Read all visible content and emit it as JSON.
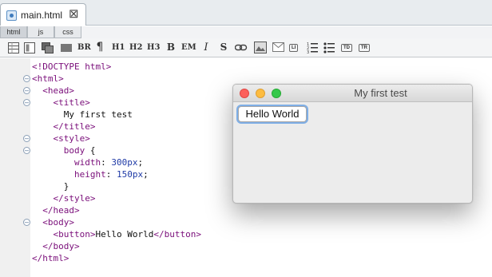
{
  "file_tab": {
    "name": "main.html",
    "close_glyph": "⊠",
    "icon": "html-file-icon"
  },
  "sub_tabs": [
    {
      "label": "html",
      "active": true
    },
    {
      "label": "js",
      "active": false
    },
    {
      "label": "css",
      "active": false
    }
  ],
  "toolbar": {
    "br": "BR",
    "pilcrow": "¶",
    "h1": "H1",
    "h2": "H2",
    "h3": "H3",
    "bold": "B",
    "em": "EM",
    "italic": "I",
    "strike": "S",
    "li": "LI",
    "td": "TD",
    "tr": "TR"
  },
  "code_lines": [
    {
      "parts": [
        [
          "tag",
          "<!DOCTYPE html>"
        ]
      ]
    },
    {
      "parts": [
        [
          "tag",
          "<html>"
        ]
      ]
    },
    {
      "parts": [
        [
          "txt",
          "  "
        ],
        [
          "tag",
          "<head>"
        ]
      ]
    },
    {
      "parts": [
        [
          "txt",
          "    "
        ],
        [
          "tag",
          "<title>"
        ]
      ]
    },
    {
      "parts": [
        [
          "txt",
          "      My first test"
        ]
      ]
    },
    {
      "parts": [
        [
          "txt",
          "    "
        ],
        [
          "tag",
          "</title>"
        ]
      ]
    },
    {
      "parts": [
        [
          "txt",
          "    "
        ],
        [
          "tag",
          "<style>"
        ]
      ]
    },
    {
      "parts": [
        [
          "txt",
          "      "
        ],
        [
          "prop",
          "body"
        ],
        [
          "txt",
          " {"
        ]
      ]
    },
    {
      "parts": [
        [
          "txt",
          "        "
        ],
        [
          "prop",
          "width"
        ],
        [
          "txt",
          ": "
        ],
        [
          "val",
          "300px"
        ],
        [
          "txt",
          ";"
        ]
      ]
    },
    {
      "parts": [
        [
          "txt",
          "        "
        ],
        [
          "prop",
          "height"
        ],
        [
          "txt",
          ": "
        ],
        [
          "val",
          "150px"
        ],
        [
          "txt",
          ";"
        ]
      ]
    },
    {
      "parts": [
        [
          "txt",
          "      }"
        ]
      ]
    },
    {
      "parts": [
        [
          "txt",
          "    "
        ],
        [
          "tag",
          "</style>"
        ]
      ]
    },
    {
      "parts": [
        [
          "txt",
          "  "
        ],
        [
          "tag",
          "</head>"
        ]
      ]
    },
    {
      "parts": [
        [
          "txt",
          "  "
        ],
        [
          "tag",
          "<body>"
        ]
      ]
    },
    {
      "parts": [
        [
          "txt",
          "    "
        ],
        [
          "tag",
          "<button>"
        ],
        [
          "txt",
          "Hello World"
        ],
        [
          "tag",
          "</button>"
        ]
      ]
    },
    {
      "parts": [
        [
          "txt",
          "  "
        ],
        [
          "tag",
          "</body>"
        ]
      ]
    },
    {
      "parts": [
        [
          "tag",
          "</html>"
        ]
      ]
    }
  ],
  "fold_rows": [
    1,
    2,
    3,
    6,
    7,
    13
  ],
  "preview_window": {
    "title": "My first test",
    "button_label": "Hello World"
  },
  "colors": {
    "tag": "#7a0e7a",
    "value": "#1f3aa6",
    "close": "#fc605b",
    "minimize": "#fdbc40",
    "zoom": "#34c84a"
  }
}
